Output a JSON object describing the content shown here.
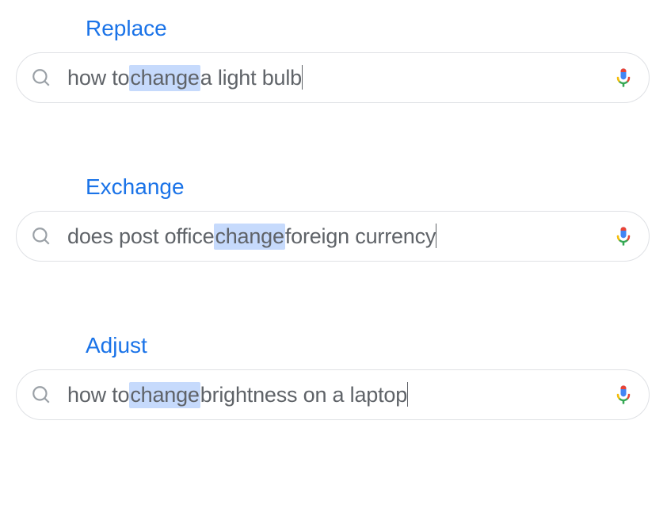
{
  "examples": [
    {
      "label": "Replace",
      "query_before": "how to ",
      "query_highlight": "change",
      "query_after": " a light bulb"
    },
    {
      "label": "Exchange",
      "query_before": "does post office ",
      "query_highlight": "change",
      "query_after": " foreign currency"
    },
    {
      "label": "Adjust",
      "query_before": "how to ",
      "query_highlight": "change",
      "query_after": " brightness on a laptop"
    }
  ]
}
